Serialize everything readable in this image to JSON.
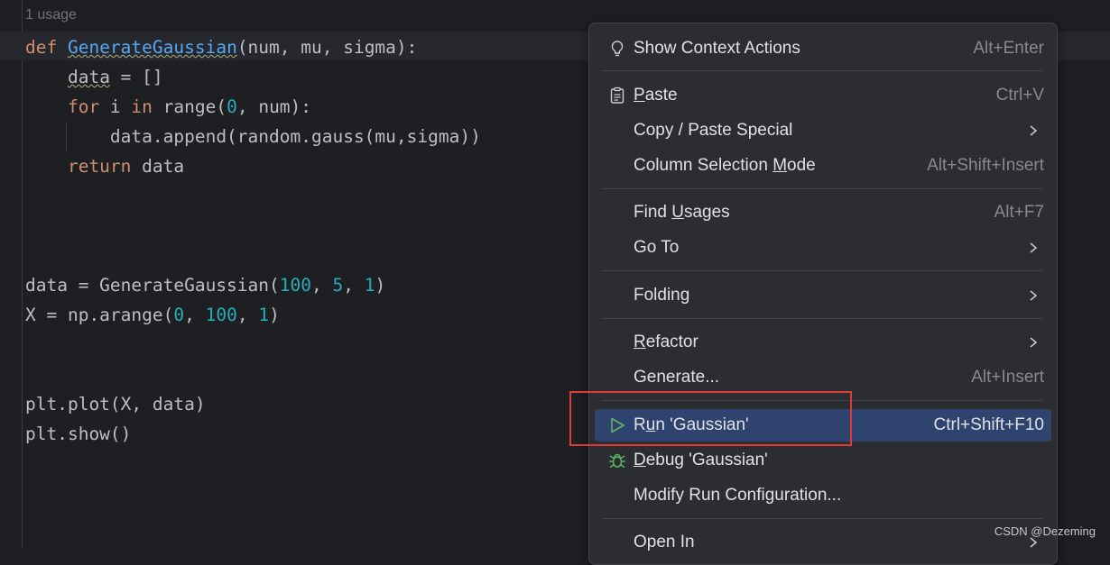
{
  "editor": {
    "usage_hint": "1 usage",
    "lines": [
      {
        "id": "l1",
        "tokens": [
          [
            "kw",
            "def "
          ],
          [
            "fn",
            "GenerateGaussian"
          ],
          [
            "",
            "(num, mu, sigma):"
          ]
        ]
      },
      {
        "id": "l2",
        "tokens": [
          [
            "",
            "    "
          ],
          [
            "wavy",
            "data"
          ],
          [
            "",
            " = []"
          ]
        ]
      },
      {
        "id": "l3",
        "tokens": [
          [
            "kw",
            "    for"
          ],
          [
            "",
            " i "
          ],
          [
            "kw",
            "in"
          ],
          [
            "",
            " range("
          ],
          [
            "num",
            "0"
          ],
          [
            "",
            ", num):"
          ]
        ]
      },
      {
        "id": "l4",
        "tokens": [
          [
            "",
            "        data.append(random.gauss(mu,sigma))"
          ]
        ]
      },
      {
        "id": "l5",
        "tokens": [
          [
            "kw",
            "    return"
          ],
          [
            "",
            " data"
          ]
        ]
      },
      {
        "id": "l6",
        "tokens": [
          [
            "",
            "data = GenerateGaussian("
          ],
          [
            "num",
            "100"
          ],
          [
            "",
            ", "
          ],
          [
            "num",
            "5"
          ],
          [
            "",
            ", "
          ],
          [
            "num",
            "1"
          ],
          [
            "",
            ")"
          ]
        ]
      },
      {
        "id": "l7",
        "tokens": [
          [
            "",
            "X = np.arange("
          ],
          [
            "num",
            "0"
          ],
          [
            "",
            ", "
          ],
          [
            "num",
            "100"
          ],
          [
            "",
            ", "
          ],
          [
            "num",
            "1"
          ],
          [
            "",
            ")"
          ]
        ]
      },
      {
        "id": "l8",
        "tokens": [
          [
            "",
            "plt.plot(X, data)"
          ]
        ]
      },
      {
        "id": "l9",
        "tokens": [
          [
            "",
            "plt.show()"
          ]
        ]
      }
    ]
  },
  "context_menu": {
    "items": [
      {
        "label": "Show Context Actions",
        "shortcut": "Alt+Enter",
        "icon": "lightbulb-icon"
      },
      {
        "label": "Paste",
        "mnemonic_first": "P",
        "rest": "aste",
        "shortcut": "Ctrl+V",
        "icon": "clipboard-icon"
      },
      {
        "label": "Copy / Paste Special",
        "submenu": true
      },
      {
        "label": "Column Selection Mode",
        "shortcut": "Alt+Shift+Insert"
      },
      {
        "label": "Find Usages",
        "shortcut": "Alt+F7"
      },
      {
        "label": "Go To",
        "submenu": true
      },
      {
        "label": "Folding",
        "submenu": true
      },
      {
        "label": "Refactor",
        "submenu": true
      },
      {
        "label": "Generate...",
        "shortcut": "Alt+Insert"
      },
      {
        "label": "Run 'Gaussian'",
        "shortcut": "Ctrl+Shift+F10",
        "icon": "run-icon",
        "selected": true
      },
      {
        "label": "Debug 'Gaussian'",
        "icon": "debug-icon"
      },
      {
        "label": "Modify Run Configuration..."
      },
      {
        "label": "Open In",
        "submenu": true
      }
    ]
  },
  "watermark": "CSDN @Dezeming",
  "colors": {
    "selection": "#2e436e",
    "highlight_box": "#e23a36",
    "run_icon": "#5fb865",
    "debug_icon": "#5fb865"
  }
}
